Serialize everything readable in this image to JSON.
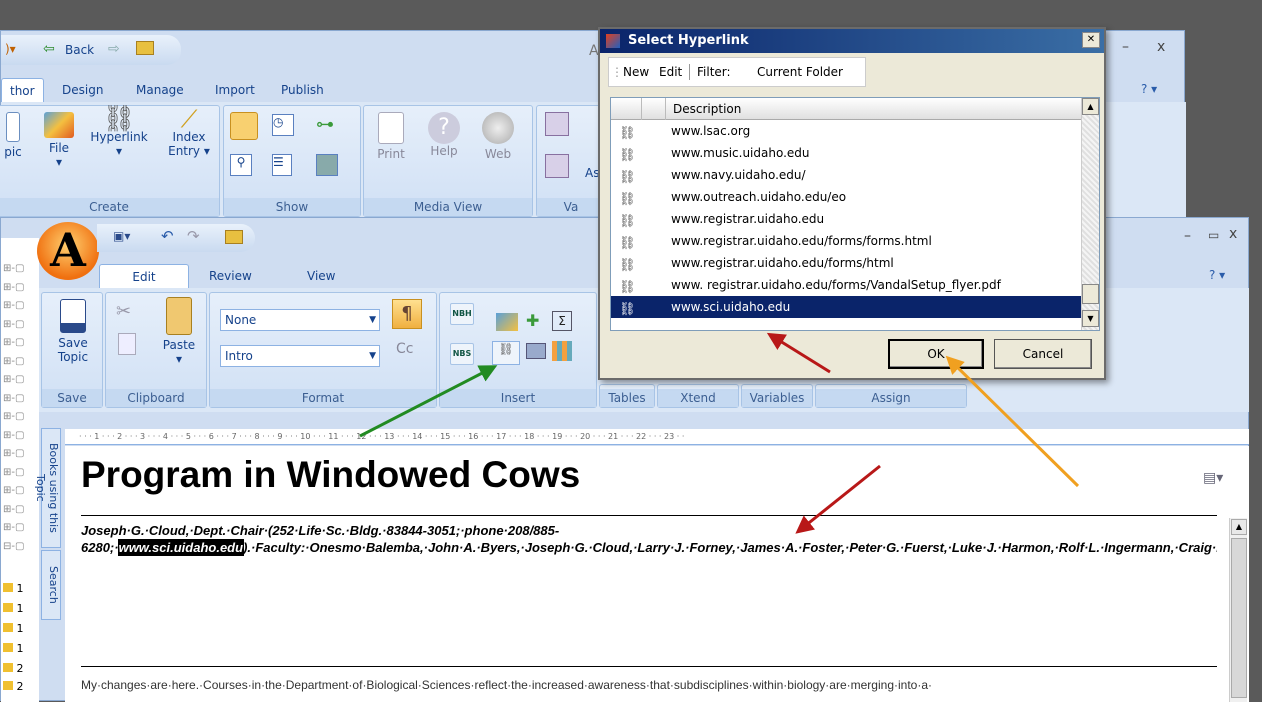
{
  "back_window": {
    "qat": {
      "back_label": "Back",
      "title_fragment": "A"
    },
    "tabs": [
      "thor",
      "Design",
      "Manage",
      "Import",
      "Publish"
    ],
    "groups": {
      "create": "Create",
      "show": "Show",
      "media_view": "Media View",
      "va": "Va"
    },
    "buttons": {
      "topic": "pic",
      "file": "File",
      "hyperlink": "Hyperlink",
      "index1": "Index",
      "index2": "Entry ▾",
      "print": "Print",
      "help": "Help",
      "web": "Web",
      "as": "As"
    },
    "controls": {
      "minimize": "–",
      "close": "x",
      "help": "? ▾"
    }
  },
  "front_window": {
    "tabs": [
      "Edit",
      "Review",
      "View"
    ],
    "controls": {
      "minimize": "–",
      "maximize": "▭",
      "close": "x",
      "help": "? ▾"
    },
    "groups": {
      "save": "Save",
      "clipboard": "Clipboard",
      "format": "Format",
      "insert": "Insert",
      "tables": "Tables",
      "xtend": "Xtend",
      "variables": "Variables",
      "assign": "Assign"
    },
    "buttons": {
      "save1": "Save",
      "save2": "Topic",
      "paste": "Paste",
      "paste_arrow": "▾"
    },
    "format": {
      "style1": "None",
      "style2": "Intro",
      "para_mark": "¶",
      "cc": "Cc"
    },
    "insert": {
      "nbh": "NBH",
      "nbs": "NBS"
    },
    "side_tabs": [
      "Books using this Topic",
      "Search"
    ],
    "ruler": "· · · 1 · · · 2 · · · 3 · · · 4 · · · 5 · · · 6 · · · 7 · · · 8 · · · 9 · · · 10 · · · 11 · · · 12 · · · 13 · · · 14 · · · 15 · · · 16 · · · 17 · · · 18 · · · 19 · · · 20 · · · 21 · · · 22 · · · 23 · ·",
    "doc": {
      "title": "Program in Windowed Cows",
      "p1_before": "Joseph·G.·Cloud,·Dept.·Chair·(252·Life·Sc.·Bldg.·83844-3051;·phone·208/885-6280;·",
      "p1_link": "www.sci.uidaho.edu",
      "p1_after": ").·Faculty:·Onesmo·Balemba,·John·A.·Byers,·Joseph·G.·Cloud,·Larry·J.·Forney,·James·A.·Foster,·Peter·G.·Fuerst,·Luke·J.·Harmon,·Rolf·L.·Ingermann,·Craig·P.·McGowan,·James·J.·Nagler,·Scott·L.·Nuismer,·Nils·O.·Pellmyr,·Barrie·D.·Robison,·Erica·B.·Rosenblum,·Deborah·L.·Stenkamp,·John·M.·Sullivan,·Eva·M.·Top,·Holly·A.·Wichman.·Research·Assistant·Professors:·Craig·Miller,·Xia·Zhou.·Lecturers:·Candi·Heimgartner,·Denim·Jochimsen,·Bruce·K.·Mobarry,·Kristin·Simokat.·Adjunct·Faculty:·James·R.·Blackman,·Henry·A.·Charlier,·Jennifer·R.·Chase,·Michael·W.·Doebeli,·Sara·J.·Heggland,·Patricia·Heglund,·Cheryl·L.·Jorcyk,·Kathy·R.·Magnusson,·Andrew·Pierce,·R.·Francis·Rosenzweig,·Irvin·R.·Schultz,·Ronald·W.·Strohmeyer,·William·P.·Young.·Affiliate·Faculty:·Celeste·Brown,·Timothy·J.·Teyler.¶",
      "p2": "My·changes·are·here.·Courses·in·the·Department·of·Biological·Sciences·reflect·the·increased·awareness·that·subdisciplines·within·biology·are·merging·into·a·"
    },
    "tree_labels": [
      "1",
      "1",
      "1",
      "1",
      "2",
      "2"
    ]
  },
  "dialog": {
    "title": "Select Hyperlink",
    "close": "✕",
    "menu": {
      "new": "New",
      "edit": "Edit",
      "filter": "Filter:",
      "filter_value": "Current Folder"
    },
    "column": "Description",
    "items": [
      "www.lsac.org",
      "www.music.uidaho.edu",
      "www.navy.uidaho.edu/",
      "www.outreach.uidaho.edu/eo",
      "www.registrar.uidaho.edu",
      "www.registrar.uidaho.edu/forms/forms.html",
      "www.registrar.uidaho.edu/forms/html",
      "www. registrar.uidaho.edu/forms/VandalSetup_flyer.pdf",
      "www.sci.uidaho.edu"
    ],
    "selected_index": 8,
    "ok": "OK",
    "cancel": "Cancel"
  },
  "colors": {
    "ribbon": "#dbe7f6",
    "title_bar": "#0a246a",
    "accent_red": "#b81818",
    "accent_green": "#228b22",
    "accent_orange": "#f0a020"
  }
}
